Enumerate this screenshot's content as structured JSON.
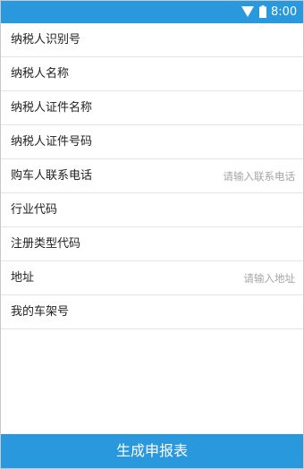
{
  "status_bar": {
    "time": "8:00",
    "icons": [
      "wifi-icon",
      "battery-icon"
    ],
    "color": "#2a98dd"
  },
  "form": {
    "fields": [
      {
        "label": "纳税人识别号",
        "placeholder": "",
        "value": ""
      },
      {
        "label": "纳税人名称",
        "placeholder": "",
        "value": ""
      },
      {
        "label": "纳税人证件名称",
        "placeholder": "",
        "value": ""
      },
      {
        "label": "纳税人证件号码",
        "placeholder": "",
        "value": ""
      },
      {
        "label": "购车人联系电话",
        "placeholder": "请输入联系电话",
        "value": ""
      },
      {
        "label": "行业代码",
        "placeholder": "",
        "value": ""
      },
      {
        "label": "注册类型代码",
        "placeholder": "",
        "value": ""
      },
      {
        "label": "地址",
        "placeholder": "请输入地址",
        "value": ""
      },
      {
        "label": "我的车架号",
        "placeholder": "",
        "value": ""
      }
    ]
  },
  "submit_button": {
    "label": "生成申报表",
    "color": "#2a98dd"
  }
}
